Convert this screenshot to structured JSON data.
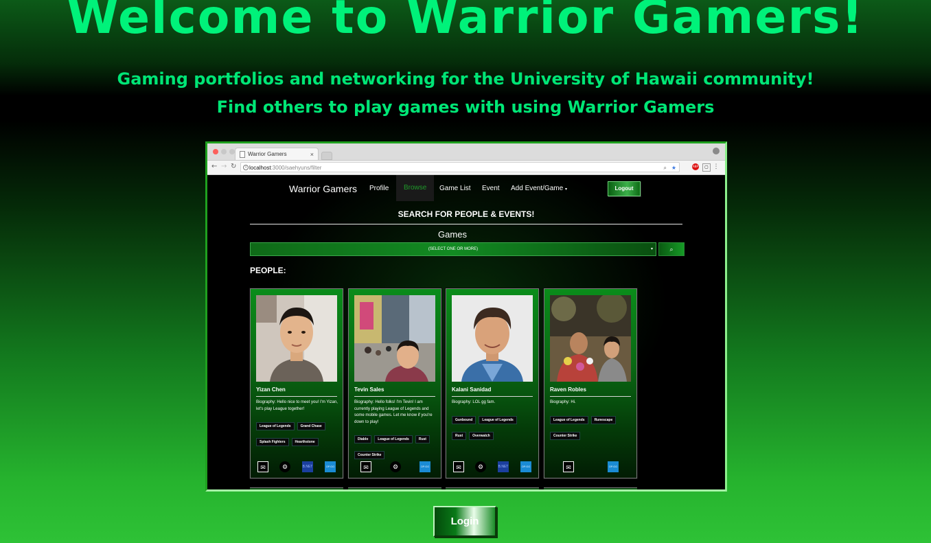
{
  "hero": {
    "title": "Welcome to Warrior Gamers!",
    "subtitle_1": "Gaming portfolios and networking for the University of Hawaii community!",
    "subtitle_2": "Find others to play games with using Warrior Gamers"
  },
  "browser": {
    "tab_title": "Warrior Gamers",
    "tab_close": "×",
    "url_host": "localhost",
    "url_path": ":3000/saehyuns/filter"
  },
  "app": {
    "brand": "Warrior Gamers",
    "nav": [
      "Profile",
      "Browse",
      "Game List",
      "Event",
      "Add Event/Game"
    ],
    "active_nav": "Browse",
    "logout": "Logout",
    "search_title": "SEARCH FOR PEOPLE & EVENTS!",
    "games_label": "Games",
    "select_placeholder": "(SELECT ONE OR MORE)",
    "people_heading": "PEOPLE:"
  },
  "people": [
    {
      "name": "Yizan Chen",
      "bio": "Biography: Hello nice to meet you! I'm Yizan, let's play League together!",
      "tags": [
        "League of Legends",
        "Grand Chase",
        "Splash Fighters",
        "Hearthstone"
      ],
      "icons": [
        "mail-icon",
        "steam-icon",
        "battlenet-icon",
        "opgg-icon"
      ]
    },
    {
      "name": "Tevin Sales",
      "bio": "Biography: Hello folks! I'm Tevin! I am currently playing League of Legends and some mobile games. Let me know if you're down to play!",
      "tags": [
        "Diablo",
        "League of Legends",
        "Rust",
        "Counter Strike"
      ],
      "icons": [
        "mail-icon",
        "steam-icon",
        "opgg-icon"
      ]
    },
    {
      "name": "Kalani Sanidad",
      "bio": "Biography: LOL gg fam.",
      "tags": [
        "Gunbound",
        "League of Legends",
        "Rust",
        "Overwatch"
      ],
      "icons": [
        "mail-icon",
        "steam-icon",
        "battlenet-icon",
        "opgg-icon"
      ]
    },
    {
      "name": "Raven Robles",
      "bio": "Biography: Hi.",
      "tags": [
        "League of Legends",
        "Runescape",
        "Counter Strike"
      ],
      "icons": [
        "mail-icon",
        "opgg-icon"
      ]
    }
  ],
  "icon_labels": {
    "opgg": "OP.GG",
    "battlenet": "B.NET",
    "mail": "✉",
    "steam": "⚙"
  },
  "login": "Login",
  "colors": {
    "accent": "#00f27a",
    "card_green": "#0a8c1a",
    "opgg_blue": "#1a8bd4"
  }
}
